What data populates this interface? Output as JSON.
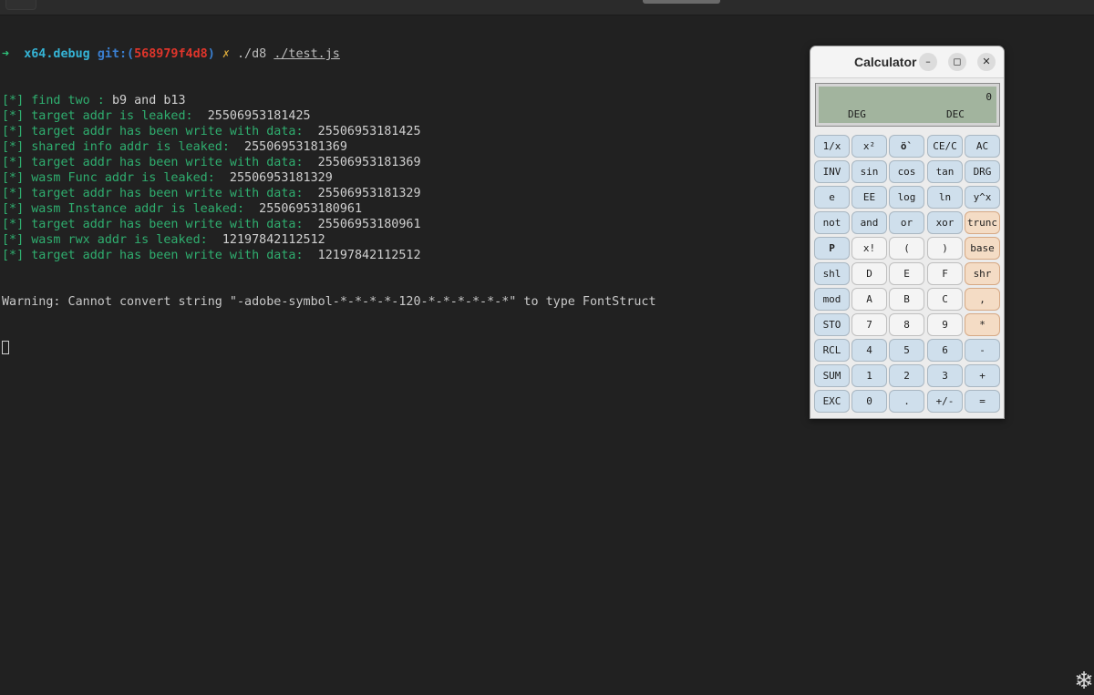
{
  "terminal": {
    "prompt": {
      "arrow": "➜",
      "dir": "x64.debug",
      "git_label": "git:(",
      "git_hash": "568979f4d8",
      "git_close": ")",
      "dirty_mark": "✗",
      "command": "./d8",
      "argument": "./test.js"
    },
    "lines": [
      {
        "prefix": "[*] find two : ",
        "value": "b9 and b13"
      },
      {
        "prefix": "[*] target addr is leaked:  ",
        "value": "25506953181425"
      },
      {
        "prefix": "[*] target addr has been write with data:  ",
        "value": "25506953181425"
      },
      {
        "prefix": "[*] shared info addr is leaked:  ",
        "value": "25506953181369"
      },
      {
        "prefix": "[*] target addr has been write with data:  ",
        "value": "25506953181369"
      },
      {
        "prefix": "[*] wasm Func addr is leaked:  ",
        "value": "25506953181329"
      },
      {
        "prefix": "[*] target addr has been write with data:  ",
        "value": "25506953181329"
      },
      {
        "prefix": "[*] wasm Instance addr is leaked:  ",
        "value": "25506953180961"
      },
      {
        "prefix": "[*] target addr has been write with data:  ",
        "value": "25506953180961"
      },
      {
        "prefix": "[*] wasm rwx addr is leaked:  ",
        "value": "12197842112512"
      },
      {
        "prefix": "[*] target addr has been write with data:  ",
        "value": "12197842112512"
      }
    ],
    "warning": "Warning: Cannot convert string \"-adobe-symbol-*-*-*-*-120-*-*-*-*-*-*\" to type FontStruct"
  },
  "calculator": {
    "title": "Calculator",
    "minimize_icon": "minimize-icon",
    "maximize_icon": "maximize-icon",
    "close_icon": "close-icon",
    "controls": {
      "minimize": "–",
      "maximize": "◻",
      "close": "✕"
    },
    "display": {
      "value": "0",
      "angle_mode": "DEG",
      "base_mode": "DEC"
    },
    "keys": [
      [
        "1/x",
        "x²",
        "ö`",
        "CE/C",
        "AC"
      ],
      [
        "INV",
        "sin",
        "cos",
        "tan",
        "DRG"
      ],
      [
        "e",
        "EE",
        "log",
        "ln",
        "y^x"
      ],
      [
        "not",
        "and",
        "or",
        "xor",
        "trunc"
      ],
      [
        "P",
        "x!",
        "(",
        ")",
        "base"
      ],
      [
        "shl",
        "D",
        "E",
        "F",
        "shr"
      ],
      [
        "mod",
        "A",
        "B",
        "C",
        ","
      ],
      [
        "STO",
        "7",
        "8",
        "9",
        "*"
      ],
      [
        "RCL",
        "4",
        "5",
        "6",
        "-"
      ],
      [
        "SUM",
        "1",
        "2",
        "3",
        "+"
      ],
      [
        "EXC",
        "0",
        ".",
        "+/-",
        "="
      ]
    ],
    "key_styles": [
      [
        "blue",
        "blue",
        "blue",
        "blue",
        "blue"
      ],
      [
        "blue",
        "blue",
        "blue",
        "blue",
        "blue"
      ],
      [
        "blue",
        "blue",
        "blue",
        "blue",
        "blue"
      ],
      [
        "blue",
        "blue",
        "blue",
        "blue",
        "orange"
      ],
      [
        "blue",
        "white",
        "white",
        "white",
        "orange"
      ],
      [
        "blue",
        "white",
        "white",
        "white",
        "orange"
      ],
      [
        "blue",
        "white",
        "white",
        "white",
        "orange"
      ],
      [
        "blue",
        "white",
        "white",
        "white",
        "orange"
      ],
      [
        "blue",
        "blue",
        "blue",
        "blue",
        "blue"
      ],
      [
        "blue",
        "blue",
        "blue",
        "blue",
        "blue"
      ],
      [
        "blue",
        "blue",
        "blue",
        "blue",
        "blue"
      ]
    ],
    "colors": {
      "lcd": "#a2b49e",
      "key_blue": "#cfdfec",
      "key_orange": "#f4dcc5",
      "key_white": "#f4f4f4"
    }
  },
  "watermark": {
    "icon": "snowflake-icon",
    "glyph": "❄"
  },
  "colors": {
    "terminal_bg": "#212121",
    "green_text": "#2fae6f",
    "prompt_cyan": "#35b4d6",
    "git_hash_red": "#e0352b"
  }
}
